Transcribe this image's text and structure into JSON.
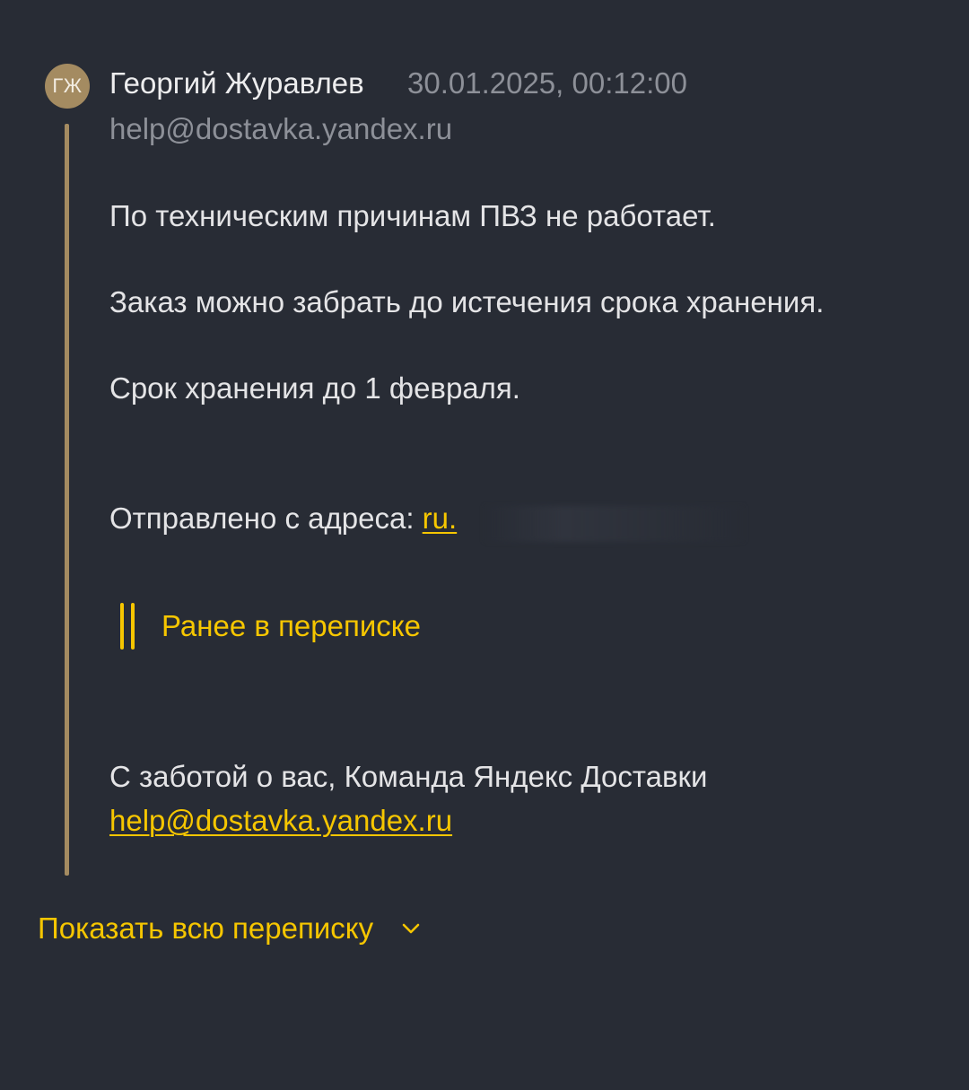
{
  "message": {
    "avatar_initials": "ГЖ",
    "sender_name": "Георгий Журавлев",
    "date": "30.01.2025, 00:12:00",
    "sender_email": "help@dostavka.yandex.ru",
    "body": [
      "По техническим причинам ПВЗ не работает.",
      "Заказ можно забрать до истечения срока хранения.",
      "Срок хранения до 1 февраля."
    ],
    "sent_from_label": "Отправлено с адреса: ",
    "sent_from_link": "ru.",
    "earlier_in_thread": "Ранее в переписке",
    "signature": "С заботой о вас, Команда Яндекс Доставки",
    "signature_email": "help@dostavka.yandex.ru"
  },
  "footer": {
    "show_all_label": "Показать всю переписку",
    "chevron_icon": "chevron-down-icon"
  },
  "colors": {
    "background": "#282c35",
    "accent": "#f6c600",
    "avatar": "#a48b61",
    "muted_text": "#8d9098"
  }
}
